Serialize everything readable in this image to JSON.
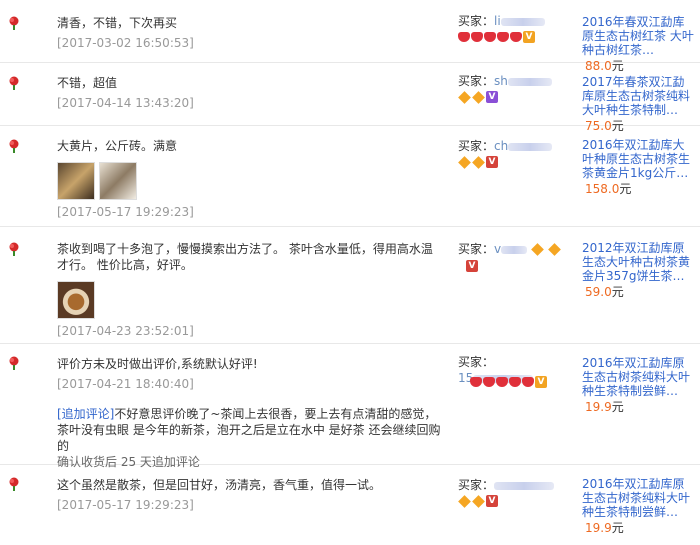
{
  "buyer_label": "买家：",
  "reviews": [
    {
      "text": "清香，不错，下次再买",
      "date": "[2017-03-02 16:50:53]",
      "buyer": "li",
      "product": "2016年春双江勐库 原生态古树红茶 大叶种古树红茶…",
      "price": "88.0",
      "unit": "元"
    },
    {
      "text": "不错，超值",
      "date": "[2017-04-14 13:43:20]",
      "buyer": "sh",
      "product": "2017年春茶双江勐库原生态古树茶纯料大叶种生茶特制…",
      "price": "75.0",
      "unit": "元"
    },
    {
      "text": "大黄片，公斤砖。满意",
      "date": "[2017-05-17 19:29:23]",
      "buyer": "ch",
      "product": "2016年双江勐库大叶种原生态古树茶生茶黄金片1kg公斤…",
      "price": "158.0",
      "unit": "元"
    },
    {
      "text": "茶收到喝了十多泡了，慢慢摸索出方法了。 茶叶含水量低，得用高水温才行。 性价比高，好评。",
      "date": "[2017-04-23 23:52:01]",
      "buyer": "v",
      "product": "2012年双江勐库原生态大叶种古树茶黄金片357g饼生茶…",
      "price": "59.0",
      "unit": "元"
    },
    {
      "text": "评价方未及时做出评价,系统默认好评!",
      "date": "[2017-04-21 18:40:40]",
      "buyer": "15",
      "product": "2016年双江勐库原生态古树茶纯料大叶种生茶特制尝鲜…",
      "price": "19.9",
      "unit": "元",
      "followup_tag": "[追加评论]",
      "followup_text": "不好意思评价晚了~茶闻上去很香，要上去有点清甜的感觉，茶叶没有虫眼 是今年的新茶，泡开之后是立在水中 是好茶 还会继续回购的",
      "followup_meta": "确认收货后 25 天追加评论"
    },
    {
      "text": "这个虽然是散茶，但是回甘好，汤清亮，香气重，值得一试。",
      "date": "[2017-05-17 19:29:23]",
      "buyer": "",
      "product": "2016年双江勐库原生态古树茶纯料大叶种生茶特制尝鲜…",
      "price": "19.9",
      "unit": "元"
    }
  ],
  "icons": {
    "rating": "red-flower-icon",
    "heart": "red-heart-icon",
    "diamond": "yellow-diamond-icon",
    "vip": "vip-badge-icon"
  },
  "colors": {
    "link": "#3366cc",
    "price": "#ee6a22",
    "date": "#999999",
    "heart": "#e0303a",
    "diamond": "#f5a623"
  }
}
